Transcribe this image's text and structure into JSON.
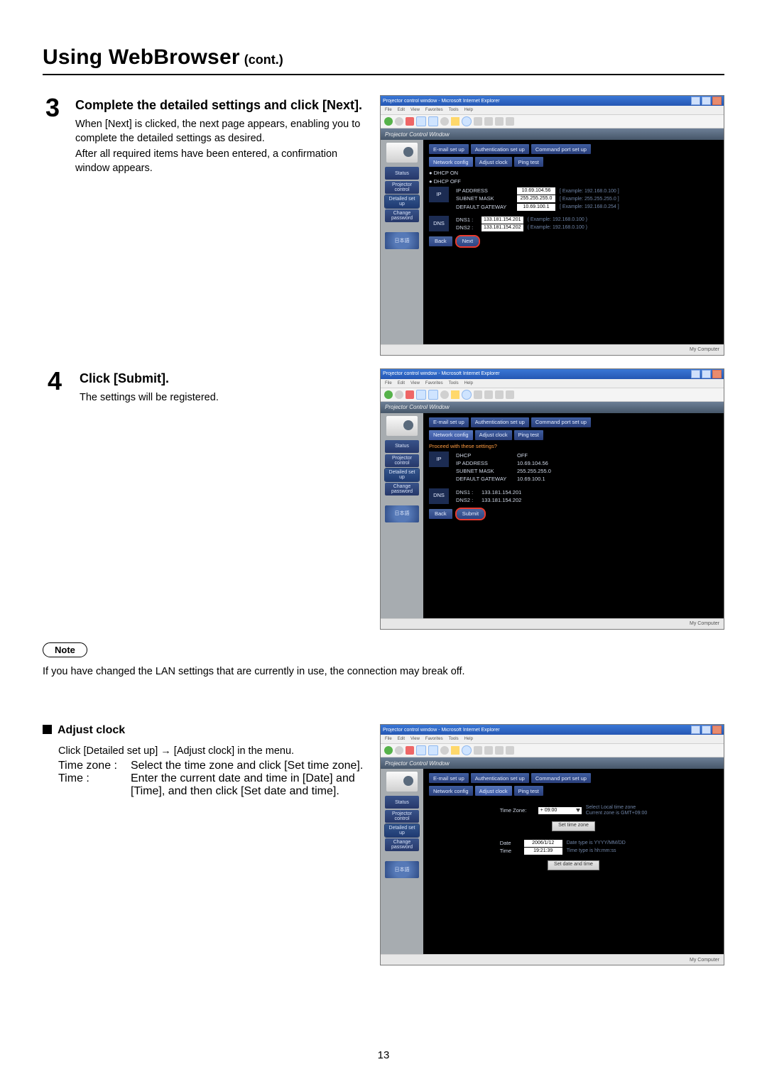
{
  "page": {
    "title_main": "Using WebBrowser",
    "title_suffix": " (cont.)",
    "page_number": "13"
  },
  "steps": {
    "s3": {
      "num": "3",
      "heading": "Complete the detailed settings and click [Next].",
      "p1": "When [Next] is clicked, the next page appears, enabling you to complete the detailed settings as desired.",
      "p2": "After all required items have been entered, a confirmation window appears."
    },
    "s4": {
      "num": "4",
      "heading": "Click [Submit].",
      "p1": "The settings will be registered."
    }
  },
  "note": {
    "label": "Note",
    "text": "If you have changed the LAN settings that are currently in use, the connection may break off."
  },
  "adjust_clock": {
    "heading": "Adjust clock",
    "intro": "Click [Detailed set up] → [Adjust clock] in the menu.",
    "rows": {
      "tz_label": "Time zone :",
      "tz_text": "Select the time zone and click [Set time zone].",
      "time_label": "Time :",
      "time_text": "Enter the current date and time in [Date] and [Time], and then click [Set date and time]."
    }
  },
  "window": {
    "title": "Projector control window - Microsoft Internet Explorer",
    "menu": {
      "file": "File",
      "edit": "Edit",
      "view": "View",
      "favorites": "Favorites",
      "tools": "Tools",
      "help": "Help"
    },
    "header": "Projector Control Window",
    "sidebar": {
      "status": "Status",
      "projector_control": "Projector control",
      "detailed_setup": "Detailed set up",
      "change_password": "Change password",
      "kanji": "日本語"
    },
    "tabs_row1": {
      "email": "E-mail set up",
      "auth": "Authentication set up",
      "comm": "Command port set up"
    },
    "tabs_row2": {
      "network": "Network config",
      "adjust": "Adjust clock",
      "ping": "Ping test"
    },
    "status_right": "My Computer"
  },
  "network_config_panel": {
    "dhcp_on": "● DHCP ON",
    "dhcp_off": "● DHCP OFF",
    "ip_box": "IP",
    "dns_box": "DNS",
    "rows": {
      "ip_addr_label": "IP ADDRESS",
      "ip_addr_val": "10.69.104.56",
      "ip_addr_hint": "[ Example: 192.168.0.100 ]",
      "subnet_label": "SUBNET MASK",
      "subnet_val": "255.255.255.0",
      "subnet_hint": "[ Example: 255.255.255.0 ]",
      "gateway_label": "DEFAULT GATEWAY",
      "gateway_val": "10.69.100.1",
      "gateway_hint": "[ Example: 192.168.0.254 ]",
      "dns1_label": "DNS1 :",
      "dns1_val": "133.181.154.201",
      "dns1_hint": "( Example: 192.168.0.100 )",
      "dns2_label": "DNS2 :",
      "dns2_val": "133.181.154.202",
      "dns2_hint": "( Example: 192.168.0.100 )"
    },
    "back": "Back",
    "next": "Next"
  },
  "submit_panel": {
    "header": "Proceed with these settings?",
    "ip_box": "IP",
    "dns_box": "DNS",
    "dhcp_label": "DHCP",
    "dhcp_val": "OFF",
    "ip_label": "IP ADDRESS",
    "ip_val": "10.69.104.56",
    "mask_label": "SUBNET MASK",
    "mask_val": "255.255.255.0",
    "gw_label": "DEFAULT GATEWAY",
    "gw_val": "10.69.100.1",
    "dns1_label": "DNS1 :",
    "dns1_val": "133.181.154.201",
    "dns2_label": "DNS2 :",
    "dns2_val": "133.181.154.202",
    "back": "Back",
    "submit": "Submit"
  },
  "clock_panel": {
    "tz_label": "Time Zone:",
    "tz_value": "+ 09:00",
    "tz_hint1": "Select Local time zone",
    "tz_hint2": "Current zone is GMT+09:00",
    "set_tz_btn": "Set time zone",
    "date_label": "Date",
    "date_val": "2006/1/12",
    "date_hint": "Date type is YYYY/MM/DD",
    "time_label": "Time",
    "time_val": "19:21:39",
    "time_hint": "Time type is hh:mm:ss",
    "set_dt_btn": "Set date and time"
  }
}
